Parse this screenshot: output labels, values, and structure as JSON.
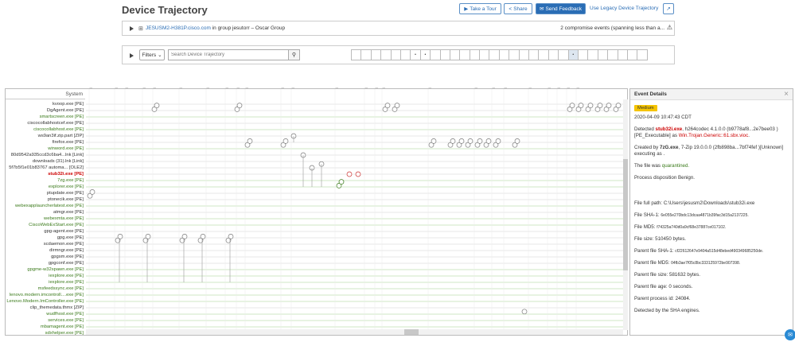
{
  "header": {
    "title": "Device Trajectory",
    "tour_label": "Take a Tour",
    "share_label": "Share",
    "feedback_label": "Send Feedback",
    "legacy_label": "Use Legacy Device Trajectory"
  },
  "group_panel": {
    "host": "JESUSM2-H381P.cisco.com",
    "group_text": "in group jesutorr – Oscar Group",
    "events_summary": "2 compromise events (spanning less than a..."
  },
  "filter_panel": {
    "filters_label": "Filters",
    "search_placeholder": "Search Device Trajectory"
  },
  "trajectory": {
    "system_label": "System",
    "processes": [
      {
        "name": "kvoop.exe [PE]",
        "c": "n"
      },
      {
        "name": "DgAgent.exe [PE]",
        "c": "n"
      },
      {
        "name": "smartscreen.exe [PE]",
        "c": "g"
      },
      {
        "name": "ciscocollabhostcef.exe [PE]",
        "c": "n"
      },
      {
        "name": "ciscocollabhost.exe [PE]",
        "c": "g"
      },
      {
        "name": "ws9an3if.zip.part [ZIP]",
        "c": "n"
      },
      {
        "name": "firefox.exe [PE]",
        "c": "n"
      },
      {
        "name": "winword.exe [PE]",
        "c": "g"
      },
      {
        "name": "80d9542a935ccd3c6ba4...lnk [Link]",
        "c": "n"
      },
      {
        "name": "downloads (31).lnk [Link]",
        "c": "n"
      },
      {
        "name": "5f7b5f1e01b83767 automa... [OLE2]",
        "c": "n"
      },
      {
        "name": "stub32i.exe [PE]",
        "c": "r"
      },
      {
        "name": "7zg.exe [PE]",
        "c": "g"
      },
      {
        "name": "explorer.exe [PE]",
        "c": "g"
      },
      {
        "name": "ptupdate.exe [PE]",
        "c": "n"
      },
      {
        "name": "ptonecik.exe [PE]",
        "c": "n"
      },
      {
        "name": "webexapplauncherlatest.exe [PE]",
        "c": "g"
      },
      {
        "name": "atmgr.exe [PE]",
        "c": "n"
      },
      {
        "name": "webexmta.exe [PE]",
        "c": "g"
      },
      {
        "name": "CiscoWebExStart.exe [PE]",
        "c": "g"
      },
      {
        "name": "gpg-agent.exe [PE]",
        "c": "n"
      },
      {
        "name": "gpg.exe [PE]",
        "c": "n"
      },
      {
        "name": "scdaemon.exe [PE]",
        "c": "n"
      },
      {
        "name": "dirmngr.exe [PE]",
        "c": "n"
      },
      {
        "name": "gpgsm.exe [PE]",
        "c": "n"
      },
      {
        "name": "gpgconf.exe [PE]",
        "c": "n"
      },
      {
        "name": "gpgme-w32spawn.exe [PE]",
        "c": "g"
      },
      {
        "name": "iexplore.exe [PE]",
        "c": "g"
      },
      {
        "name": "iexplore.exe [PE]",
        "c": "g"
      },
      {
        "name": "msfeedssync.exe [PE]",
        "c": "g"
      },
      {
        "name": "lenovo.modern.imcontroll....exe [PE]",
        "c": "g"
      },
      {
        "name": "Lenovo.Modern.ImController.exe [PE]",
        "c": "g"
      },
      {
        "name": "clip_themedata.thmx [ZIP]",
        "c": "n"
      },
      {
        "name": "wudfhost.exe [PE]",
        "c": "g"
      },
      {
        "name": "services.exe [PE]",
        "c": "g"
      },
      {
        "name": "mbamagent.exe [PE]",
        "c": "g"
      },
      {
        "name": "sdxhelper.exe [PE]",
        "c": "g"
      }
    ]
  },
  "details": {
    "title": "Event Details",
    "severity": "Medium",
    "timestamp": "2020-04-09 10:47:43 CDT",
    "detected_prefix": "Detected",
    "detected_file": "stub32i.exe",
    "detected_mid": ", h264codec 4.1.0.0 (b9778af8...2e7bee03 )[PE_Executable] as",
    "detected_threat": "Win.Trojan.Generic::61.sbx.vioc",
    "created_prefix": "Created by",
    "created_file": "7zG.exe",
    "created_rest": ", 7-Zip 19.0.0.0 (2fb898ba...7bf74fef )[Unknown] executing as .",
    "quarantine_prefix": "The file was",
    "quarantine_status": "quarantined.",
    "disposition": "Process disposition Benign.",
    "full_path_label": "File full path:",
    "full_path": "C:\\Users\\jesusm2\\Downloads\\stub32i.exe",
    "sha1_label": "File SHA-1:",
    "sha1": "6e055e270bdc13dcaa4871b39fac3d15a2137225.",
    "md5_label": "File MD5:",
    "md5": "f74325a740d0a9cf68e37887ce017102.",
    "size_label": "File size:",
    "size": "510450 bytes.",
    "parent_sha1_label": "Parent file SHA-1:",
    "parent_sha1": "cf22612647e9404a515d48ebed490349685250de.",
    "parent_md5_label": "Parent file MD5:",
    "parent_md5": "04fb3ae7f05c8bc333125972be907398.",
    "parent_size_label": "Parent file size:",
    "parent_size": "581632 bytes.",
    "parent_age_label": "Parent file age:",
    "parent_age": "0 seconds.",
    "parent_pid_label": "Parent process id:",
    "parent_pid": "24084.",
    "engine_text": "Detected by the SHA engines."
  }
}
